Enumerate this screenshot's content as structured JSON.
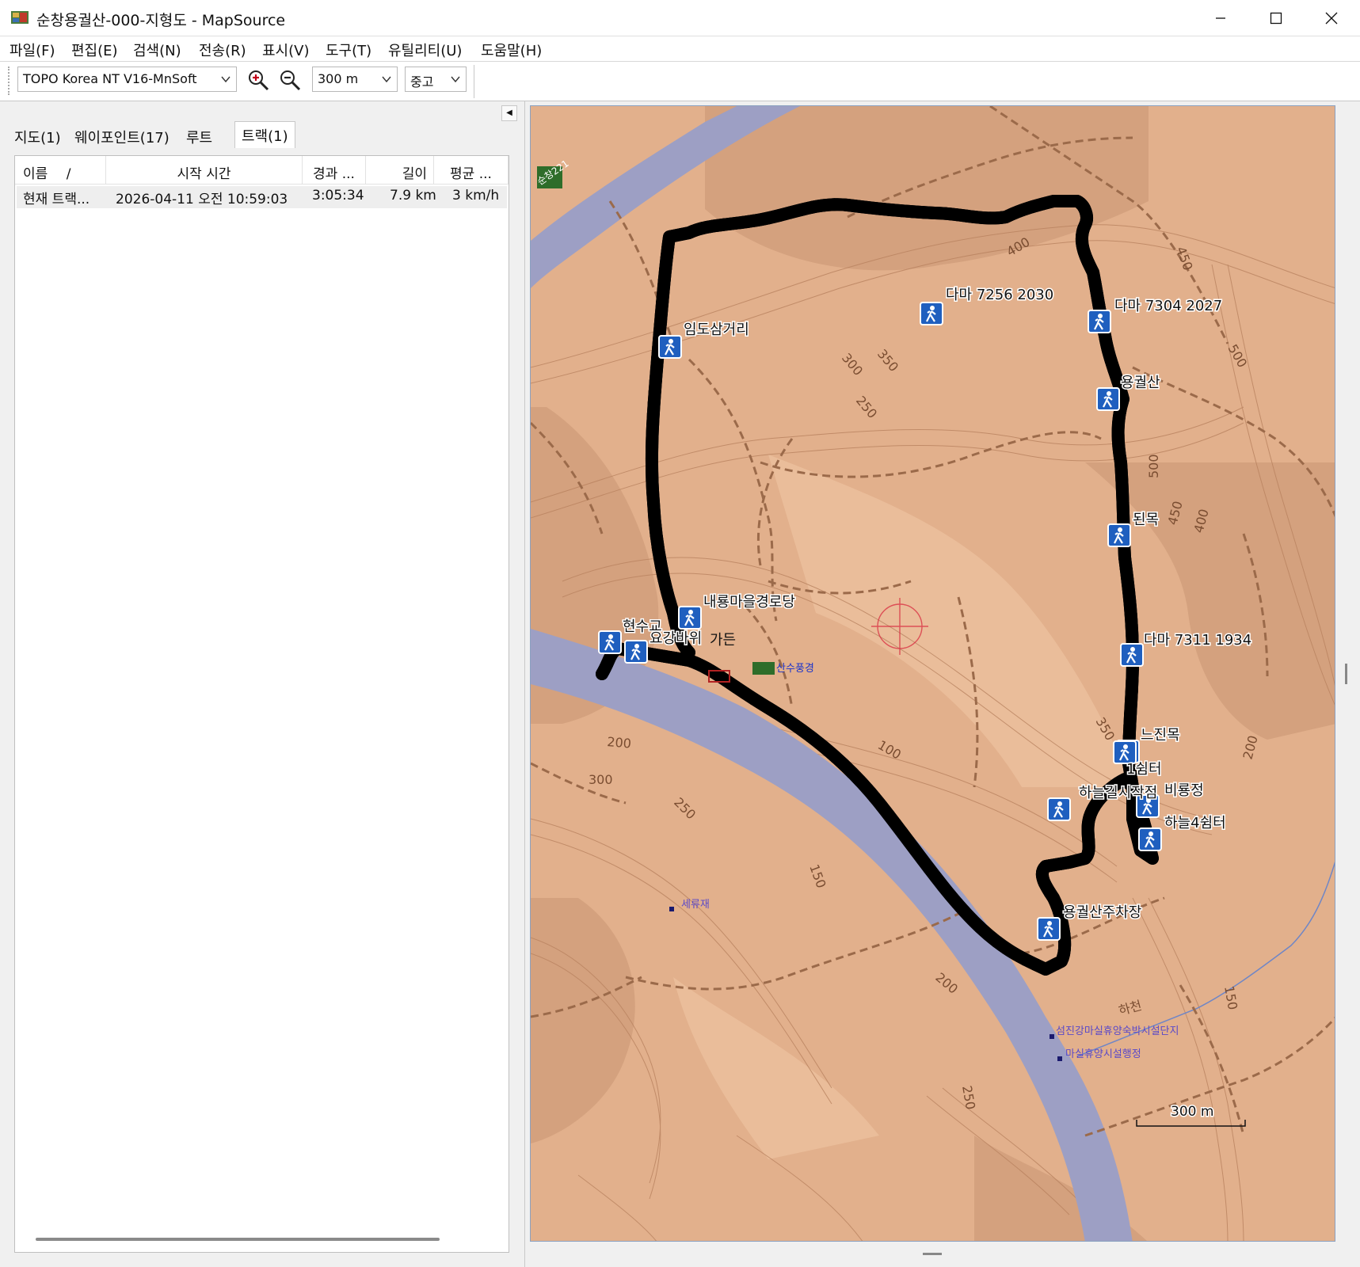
{
  "window": {
    "title": "순창용궐산-000-지형도 - MapSource",
    "minimize": "—",
    "maximize": "☐",
    "close": "✕"
  },
  "menu": [
    "파일(F)",
    "편집(E)",
    "검색(N)",
    "전송(R)",
    "표시(V)",
    "도구(T)",
    "유틸리티(U)",
    "도움말(H)"
  ],
  "toolbar": {
    "map_product": "TOPO Korea NT V16-MnSoft",
    "zoom_scale": "300 m",
    "detail": "중고"
  },
  "tabs": [
    "지도(1)",
    "웨이포인트(17)",
    "루트",
    "트랙(1)"
  ],
  "active_tab": "트랙(1)",
  "track_list": {
    "columns": [
      "이름",
      "/",
      "시작 시간",
      "경과 ...",
      "길이",
      "평균 ..."
    ],
    "rows": [
      {
        "name": "현재 트랙...",
        "start": "2026-04-11 오전 10:59:03",
        "elapsed": "3:05:34",
        "length": "7.9 km",
        "avg": "3 km/h"
      }
    ]
  },
  "map": {
    "waypoints": [
      "다마 7256 2030",
      "다마 7304 2027",
      "임도삼거리",
      "용궐산",
      "된목",
      "내룡마을경로당",
      "현수교",
      "요강바위",
      "다마 7311 1934",
      "느진목",
      "1쉼터",
      "하늘길시작점",
      "비룡정",
      "하늘4쉼터",
      "용궐산주차장"
    ],
    "place_labels": [
      "가든",
      "산수풍경",
      "세류재",
      "섬진강마실휴양숙박시설단지",
      "마실휴양시설행정",
      "하천",
      "순창221"
    ],
    "contour_labels": [
      "400",
      "450",
      "500",
      "300",
      "350",
      "250",
      "500",
      "450",
      "400",
      "200",
      "300",
      "250",
      "150",
      "200",
      "150",
      "250",
      "350",
      "200",
      "100"
    ],
    "scale_label": "300 m",
    "colors": {
      "terrain": "#e2b08c",
      "river": "#9d9fc4",
      "track": "#e8000b",
      "contour": "#b98360",
      "trail": "#9b6a4a"
    }
  }
}
